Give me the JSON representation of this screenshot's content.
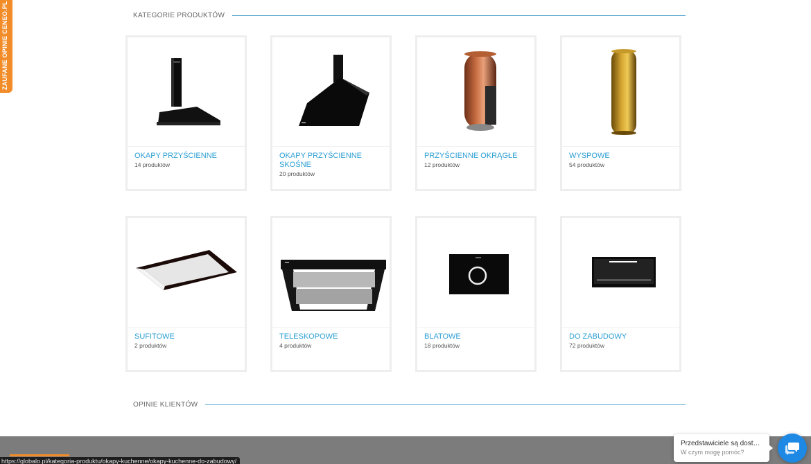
{
  "side_badge": {
    "label": "ZAUFANE OPINIE CENEO.PL",
    "color": "#f28c28"
  },
  "sections": {
    "categories_title": "KATEGORIE PRODUKTÓW",
    "reviews_title": "OPINIE KLIENTÓW"
  },
  "categories": [
    {
      "name": "OKAPY PRZYŚCIENNE",
      "count": "14 produktów",
      "icon": "wall-chimney-hood-icon"
    },
    {
      "name": "OKAPY PRZYŚCIENNE SKOŚNE",
      "count": "20 produktów",
      "icon": "angled-wall-hood-icon"
    },
    {
      "name": "PRZYŚCIENNE OKRĄGŁE",
      "count": "12 produktów",
      "icon": "round-wall-hood-icon"
    },
    {
      "name": "WYSPOWE",
      "count": "54 produktów",
      "icon": "island-hood-icon"
    },
    {
      "name": "SUFITOWE",
      "count": "2 produktów",
      "icon": "ceiling-hood-icon"
    },
    {
      "name": "TELESKOPOWE",
      "count": "4 produktów",
      "icon": "telescopic-hood-icon"
    },
    {
      "name": "BLATOWE",
      "count": "18 produktów",
      "icon": "countertop-hood-icon"
    },
    {
      "name": "DO ZABUDOWY",
      "count": "72 produktów",
      "icon": "built-in-hood-icon"
    }
  ],
  "status_bar": {
    "url": "https://globalo.pl/kategoria-produktu/okapy-kuchenne/okapy-kuchenne-do-zabudowy/"
  },
  "chat": {
    "line1": "Przedstawiciele są dostępni",
    "line2": "W czym mogę pomóc?",
    "icon": "chat-icon",
    "color": "#1e88e5"
  },
  "colors": {
    "accent": "#2e9fd4",
    "footer": "#7c7c7c",
    "orange": "#f28c28"
  }
}
